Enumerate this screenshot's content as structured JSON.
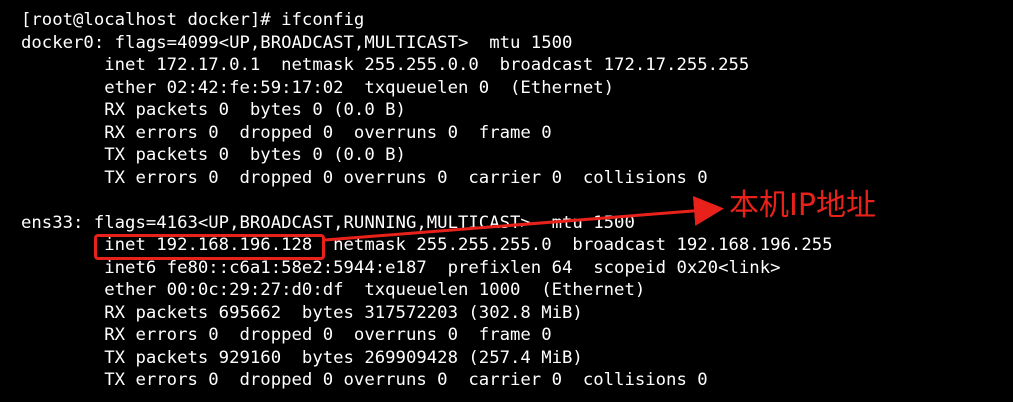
{
  "terminal": {
    "lines": [
      "[root@localhost docker]# ifconfig",
      "docker0: flags=4099<UP,BROADCAST,MULTICAST>  mtu 1500",
      "        inet 172.17.0.1  netmask 255.255.0.0  broadcast 172.17.255.255",
      "        ether 02:42:fe:59:17:02  txqueuelen 0  (Ethernet)",
      "        RX packets 0  bytes 0 (0.0 B)",
      "        RX errors 0  dropped 0  overruns 0  frame 0",
      "        TX packets 0  bytes 0 (0.0 B)",
      "        TX errors 0  dropped 0 overruns 0  carrier 0  collisions 0",
      "",
      "ens33: flags=4163<UP,BROADCAST,RUNNING,MULTICAST>  mtu 1500",
      "        inet 192.168.196.128  netmask 255.255.255.0  broadcast 192.168.196.255",
      "        inet6 fe80::c6a1:58e2:5944:e187  prefixlen 64  scopeid 0x20<link>",
      "        ether 00:0c:29:27:d0:df  txqueuelen 1000  (Ethernet)",
      "        RX packets 695662  bytes 317572203 (302.8 MiB)",
      "        RX errors 0  dropped 0  overruns 0  frame 0",
      "        TX packets 929160  bytes 269909428 (257.4 MiB)",
      "        TX errors 0  dropped 0 overruns 0  carrier 0  collisions 0"
    ]
  },
  "annotation": {
    "label": "本机IP地址",
    "color": "#e8221a"
  },
  "colors": {
    "background": "#000000",
    "text": "#ffffff",
    "annotation": "#e8221a"
  }
}
